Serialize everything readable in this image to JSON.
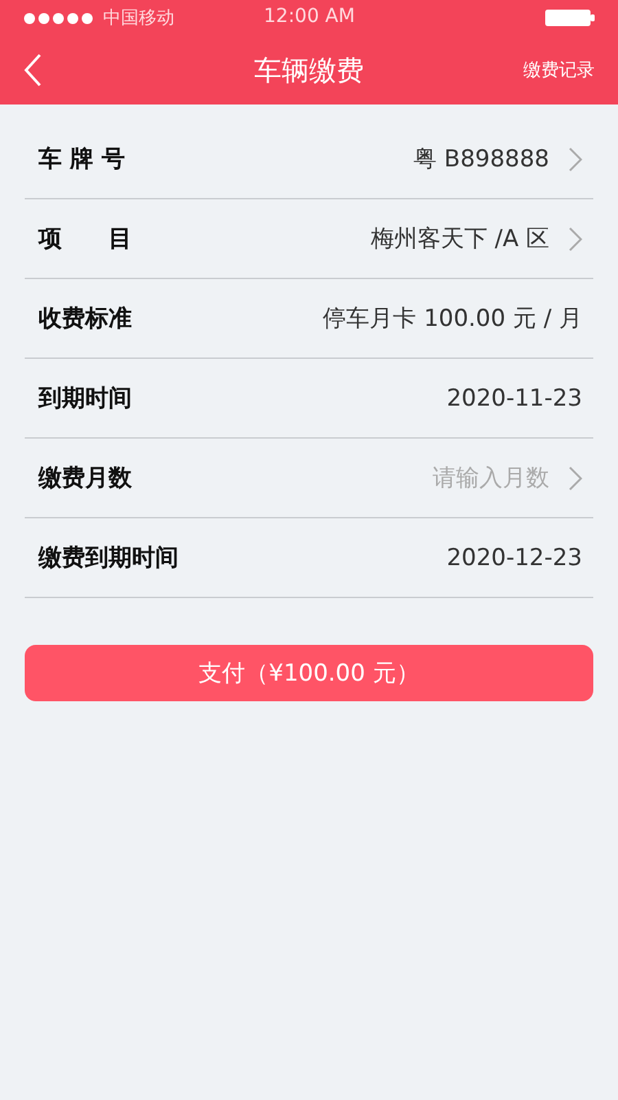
{
  "status_bar": {
    "carrier": "中国移动",
    "time": "12:00 AM"
  },
  "nav": {
    "title": "车辆缴费",
    "action": "缴费记录"
  },
  "rows": [
    {
      "kind": "value",
      "label": "车 牌 号",
      "value": "粤 B898888",
      "chevron": true
    },
    {
      "kind": "value",
      "label": "项　　目",
      "value": "梅州客天下 /A 区",
      "chevron": true
    },
    {
      "kind": "value",
      "label": "收费标准",
      "value": "停车月卡 100.00 元 / 月",
      "chevron": false
    },
    {
      "kind": "value",
      "label": "到期时间",
      "value": "2020-11-23",
      "chevron": false
    },
    {
      "kind": "input",
      "label": "缴费月数",
      "placeholder": "请输入月数",
      "chevron": true
    },
    {
      "kind": "value",
      "label": "缴费到期时间",
      "value": "2020-12-23",
      "chevron": false
    }
  ],
  "pay_button": "支付（¥100.00 元）"
}
